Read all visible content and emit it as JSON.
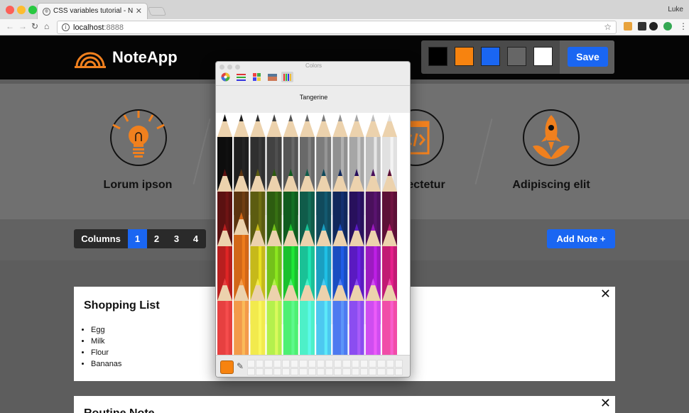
{
  "browser": {
    "tab_title": "CSS variables tutorial - NoteApp",
    "tab_close": "✕",
    "url_host": "localhost",
    "url_port": ":8888",
    "user": "Luke",
    "traffic_lights": [
      "#fc5f57",
      "#fdbc2e",
      "#28c840"
    ]
  },
  "header": {
    "brand": "NoteApp",
    "accent_color": "#f0801e",
    "swatches": [
      "#000000",
      "#f7830f",
      "#1a66f2",
      "#666666",
      "#ffffff"
    ],
    "save_label": "Save"
  },
  "features": [
    {
      "title": "Lorum ipson",
      "icon": "lightbulb-icon"
    },
    {
      "title": "ectetur",
      "icon": "code-icon"
    },
    {
      "title": "Adipiscing elit",
      "icon": "rocket-icon"
    }
  ],
  "controls": {
    "columns_label": "Columns",
    "options": [
      "1",
      "2",
      "3",
      "4"
    ],
    "selected": "1",
    "add_note_label": "Add Note +"
  },
  "notes": [
    {
      "title": "Shopping List",
      "items": [
        "Egg",
        "Milk",
        "Flour",
        "Bananas"
      ],
      "close": "✕"
    },
    {
      "title": "Routine Note",
      "items": [],
      "close": "✕"
    }
  ],
  "color_picker": {
    "window_title": "Colors",
    "selected_color_name": "Tangerine",
    "current_color": "#f7830f",
    "tabs": [
      "color-wheel-icon",
      "color-sliders-icon",
      "color-palettes-icon",
      "image-palettes-icon",
      "crayons-icon"
    ],
    "pencil_rows": [
      [
        "#0d0d0d",
        "#1f1f1f",
        "#303030",
        "#424242",
        "#555555",
        "#696969",
        "#7c7c7c",
        "#919191",
        "#a6a6a6",
        "#bdbdbd",
        "#e1e1e1"
      ],
      [
        "#5b1111",
        "#5c3410",
        "#5c5c10",
        "#2d5c10",
        "#105c1f",
        "#105c4a",
        "#104a5c",
        "#10285c",
        "#28105c",
        "#4a105c",
        "#5c1036"
      ],
      [
        "#b81f1f",
        "#d26718",
        "#c6b91a",
        "#74c11a",
        "#1ac12e",
        "#1ac196",
        "#1a9fc1",
        "#1a4dc1",
        "#5a1ac1",
        "#9d1ac1",
        "#c11a74"
      ],
      [
        "#e64040",
        "#f39a4a",
        "#f2ea4d",
        "#b4f04d",
        "#4df073",
        "#4df0c8",
        "#4dc8f0",
        "#4d7af0",
        "#8b4df0",
        "#cf4df0",
        "#f04da8"
      ]
    ]
  }
}
